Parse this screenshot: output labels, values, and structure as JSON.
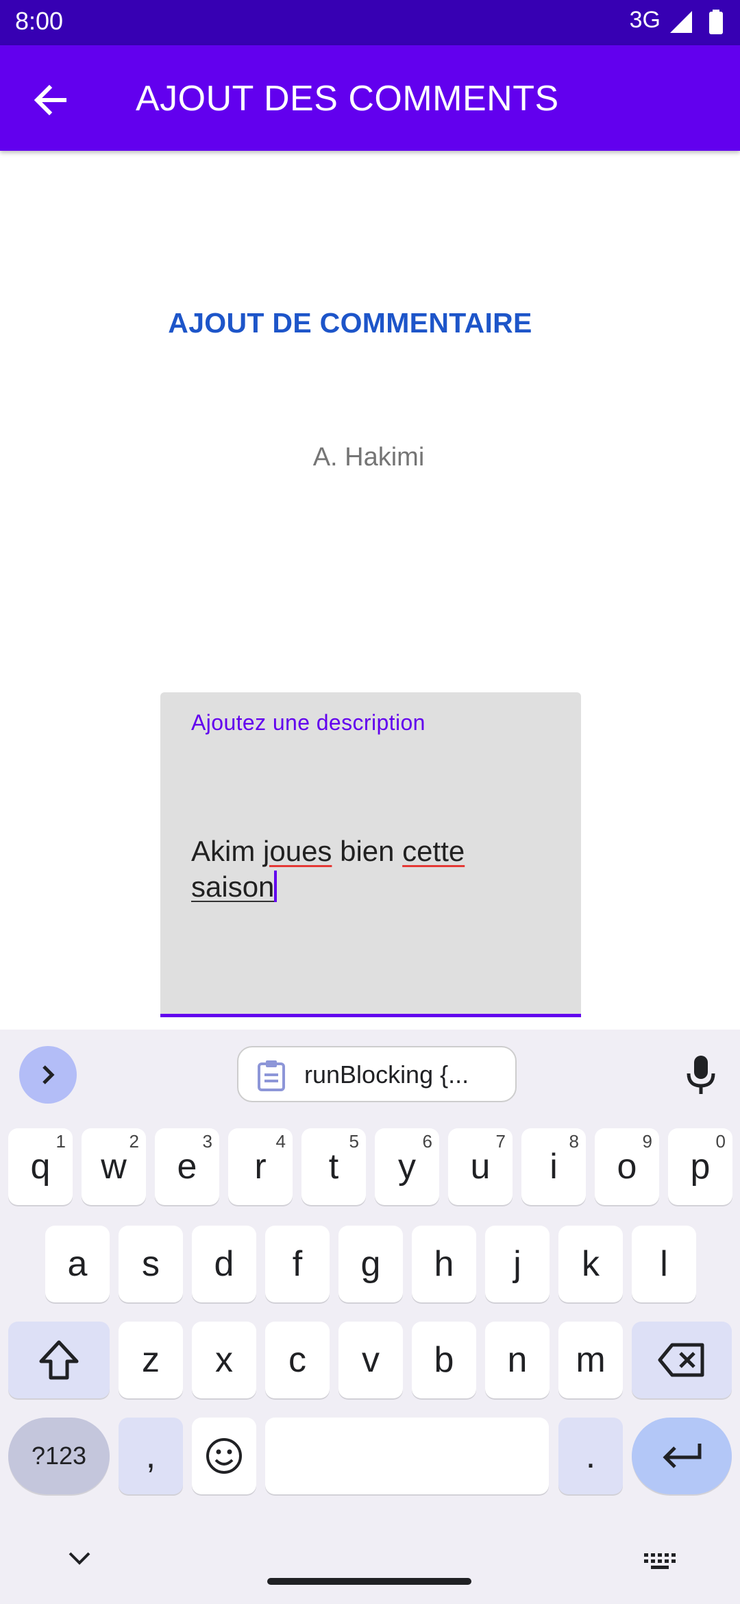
{
  "status_bar": {
    "time": "8:00",
    "network": "3G"
  },
  "app_bar": {
    "title": "AJOUT DES COMMENTS"
  },
  "content": {
    "heading": "AJOUT DE COMMENTAIRE",
    "player_name": "A. Hakimi",
    "description_field": {
      "label": "Ajoutez une description",
      "value_words": [
        "Akim",
        "joues",
        "bien",
        "cette",
        "saison"
      ]
    }
  },
  "keyboard": {
    "suggestion_chip": "runBlocking {...",
    "row1": [
      {
        "key": "q",
        "hint": "1"
      },
      {
        "key": "w",
        "hint": "2"
      },
      {
        "key": "e",
        "hint": "3"
      },
      {
        "key": "r",
        "hint": "4"
      },
      {
        "key": "t",
        "hint": "5"
      },
      {
        "key": "y",
        "hint": "6"
      },
      {
        "key": "u",
        "hint": "7"
      },
      {
        "key": "i",
        "hint": "8"
      },
      {
        "key": "o",
        "hint": "9"
      },
      {
        "key": "p",
        "hint": "0"
      }
    ],
    "row2": [
      "a",
      "s",
      "d",
      "f",
      "g",
      "h",
      "j",
      "k",
      "l"
    ],
    "row3": [
      "z",
      "x",
      "c",
      "v",
      "b",
      "n",
      "m"
    ],
    "symbols_label": "?123",
    "comma": ",",
    "period": "."
  },
  "colors": {
    "status_bar": "#3700b3",
    "app_bar": "#6200ee",
    "heading": "#1d55c9",
    "field_background": "#dfdfdf",
    "keyboard_background": "#f0eef5"
  },
  "icons": {
    "back": "arrow-left-icon",
    "signal": "signal-icon",
    "battery": "battery-icon",
    "expand": "chevron-right-icon",
    "clipboard": "clipboard-icon",
    "mic": "mic-icon",
    "shift": "shift-icon",
    "backspace": "backspace-icon",
    "emoji": "emoji-icon",
    "enter": "enter-icon",
    "hide_keyboard": "chevron-down-icon",
    "keyboard_switch": "keyboard-icon"
  }
}
